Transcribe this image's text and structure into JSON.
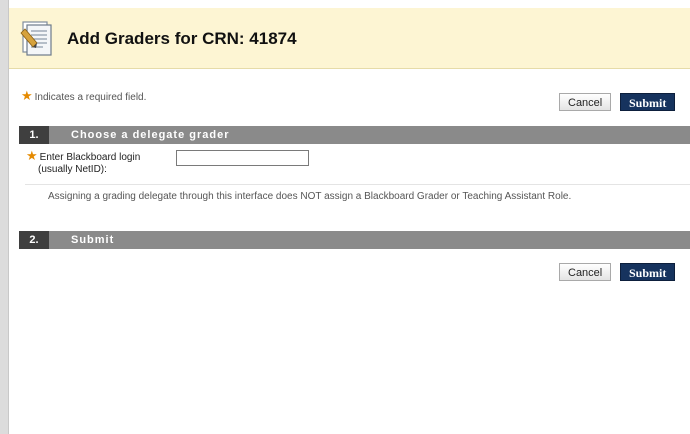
{
  "header": {
    "title": "Add Graders for CRN: 41874",
    "icon": "document-pencil-icon"
  },
  "required_note": {
    "star": "★",
    "text": "Indicates a required field."
  },
  "buttons": {
    "cancel_label": "Cancel",
    "submit_label": "Submit"
  },
  "section1": {
    "number": "1.",
    "title": "Choose a delegate grader",
    "field_star": "★",
    "field_label_line1": "Enter Blackboard login",
    "field_label_line2": "(usually NetID):",
    "field_value": "",
    "help": "Assigning a grading delegate through this interface does NOT assign a Blackboard Grader or Teaching Assistant Role."
  },
  "section2": {
    "number": "2.",
    "title": "Submit"
  },
  "colors": {
    "header_bg": "#fdf5d3",
    "section_bar": "#8a8a8a",
    "section_num_bg": "#3f3f3f",
    "submit_bg": "#16335e",
    "required_star": "#e58a00"
  }
}
